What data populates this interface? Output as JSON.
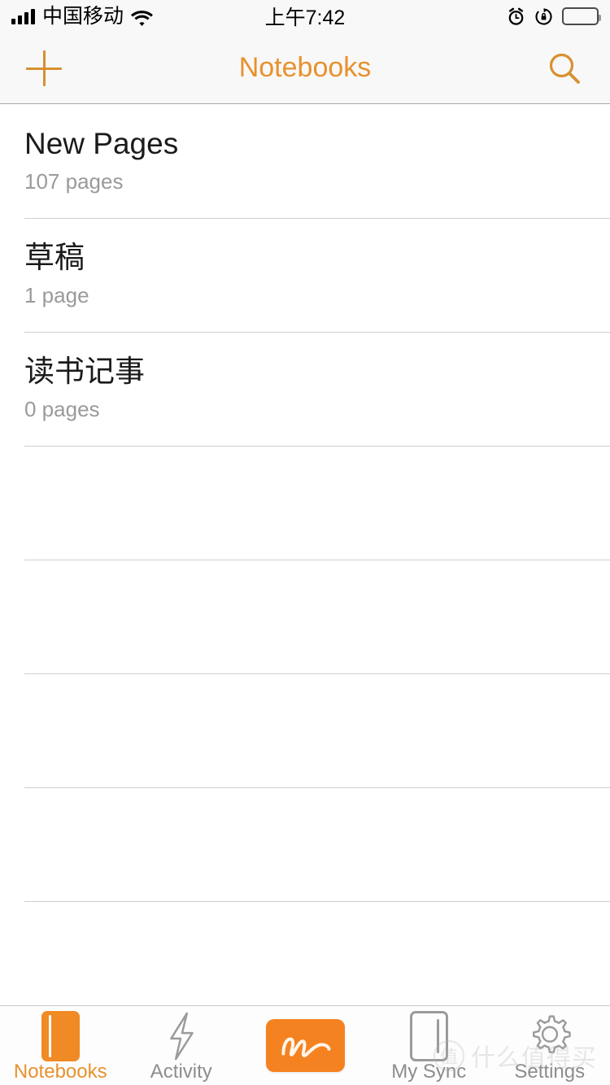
{
  "status_bar": {
    "carrier": "中国移动",
    "time": "上午7:42",
    "signal_icon": "signal-bars-icon",
    "wifi_icon": "wifi-icon",
    "alarm_icon": "alarm-clock-icon",
    "rotation_lock_icon": "rotation-lock-icon",
    "battery_icon": "battery-full-icon"
  },
  "nav": {
    "title": "Notebooks",
    "add_icon": "plus-icon",
    "search_icon": "search-icon",
    "accent_color": "#e8912d"
  },
  "notebooks": [
    {
      "title": "New Pages",
      "subtitle": "107 pages"
    },
    {
      "title": "草稿",
      "subtitle": "1 page"
    },
    {
      "title": "读书记事",
      "subtitle": "0 pages"
    }
  ],
  "empty_rows": 5,
  "tabs": [
    {
      "label": "Notebooks",
      "icon": "book-filled-icon",
      "active": true
    },
    {
      "label": "Activity",
      "icon": "lightning-bolt-icon",
      "active": false
    },
    {
      "label": "",
      "icon": "neo-logo-icon",
      "active": false
    },
    {
      "label": "My Sync",
      "icon": "notebook-outline-icon",
      "active": false
    },
    {
      "label": "Settings",
      "icon": "gear-icon",
      "active": false
    }
  ],
  "watermark": {
    "mark": "值",
    "text": "什么值得买"
  }
}
